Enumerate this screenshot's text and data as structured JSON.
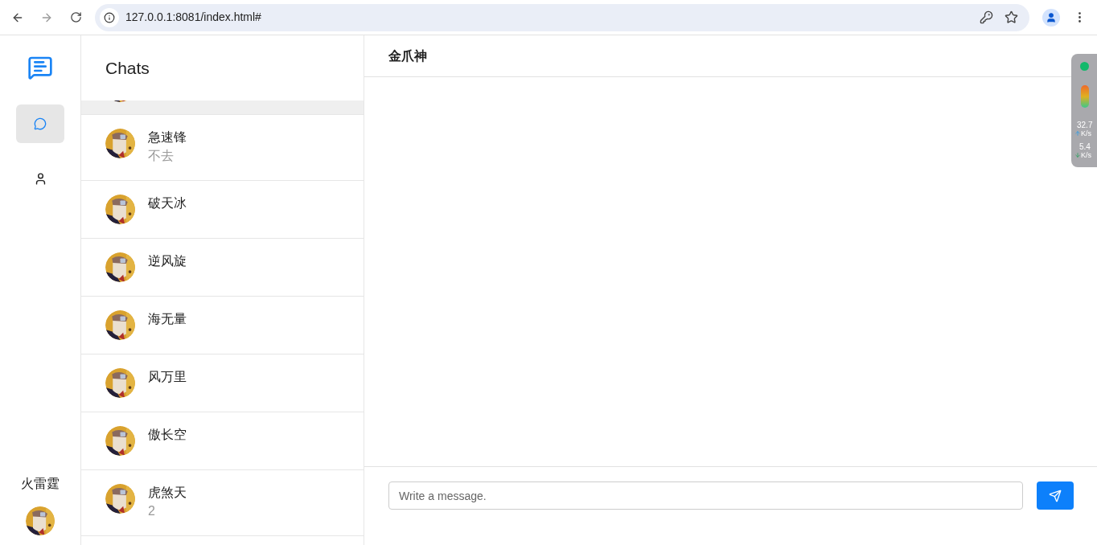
{
  "browser": {
    "url": "127.0.0.1:8081/index.html#"
  },
  "nav": [
    {
      "kind": "chats",
      "selected": true
    },
    {
      "kind": "contacts",
      "selected": false
    }
  ],
  "current_user": {
    "name": "火雷霆"
  },
  "chat_list": {
    "title": "Chats",
    "items": [
      {
        "cut": true,
        "selected": true
      },
      {
        "name": "急速锋",
        "preview": "不去",
        "selected": false
      },
      {
        "name": "破天冰",
        "selected": false
      },
      {
        "name": "逆风旋",
        "selected": false
      },
      {
        "name": "海无量",
        "selected": false
      },
      {
        "name": "风万里",
        "selected": false
      },
      {
        "name": "傲长空",
        "selected": false
      },
      {
        "name": "虎煞天",
        "preview": "2",
        "selected": false
      }
    ]
  },
  "conversation": {
    "title": "金爪神",
    "composer": {
      "placeholder": "Write a message."
    }
  },
  "net_widget": {
    "upload": "32.7",
    "upload_unit": "K/s",
    "download": "5.4",
    "download_unit": "K/s"
  }
}
